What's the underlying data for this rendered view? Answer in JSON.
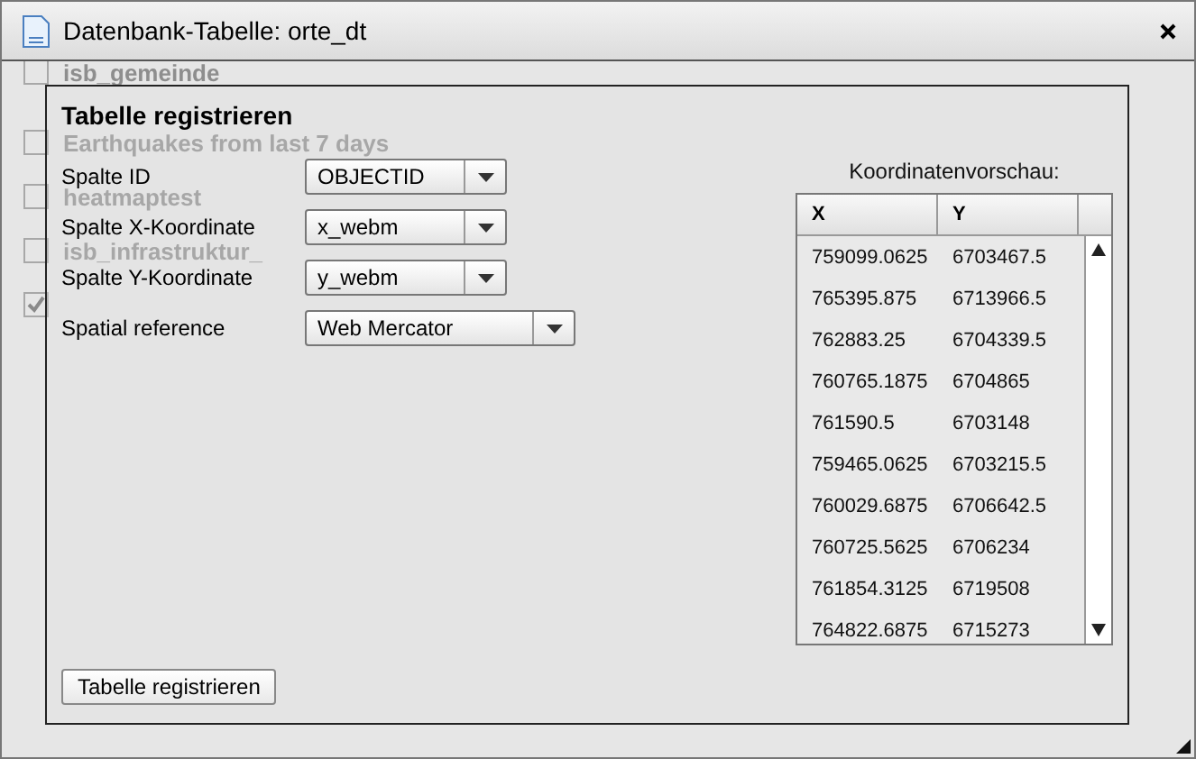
{
  "window": {
    "title": "Datenbank-Tabelle: orte_dt"
  },
  "background_layers": [
    {
      "name": "isb_gemeinde",
      "checked": false
    },
    {
      "name": "Earthquakes from last 7 days",
      "checked": false
    },
    {
      "name": "heatmaptest",
      "checked": false
    },
    {
      "name": "isb_infrastruktur_",
      "checked": false
    },
    {
      "checked": true
    }
  ],
  "panel": {
    "title": "Tabelle registrieren",
    "fields": [
      {
        "label": "Spalte ID",
        "value": "OBJECTID",
        "wide": false
      },
      {
        "label": "Spalte X-Koordinate",
        "value": "x_webm",
        "wide": false
      },
      {
        "label": "Spalte Y-Koordinate",
        "value": "y_webm",
        "wide": false
      },
      {
        "label": "Spatial reference",
        "value": "Web Mercator",
        "wide": true
      }
    ],
    "preview": {
      "title": "Koordinatenvorschau:",
      "columns": [
        "X",
        "Y"
      ],
      "rows": [
        [
          "759099.0625",
          "6703467.5"
        ],
        [
          "765395.875",
          "6713966.5"
        ],
        [
          "762883.25",
          "6704339.5"
        ],
        [
          "760765.1875",
          "6704865"
        ],
        [
          "761590.5",
          "6703148"
        ],
        [
          "759465.0625",
          "6703215.5"
        ],
        [
          "760029.6875",
          "6706642.5"
        ],
        [
          "760725.5625",
          "6706234"
        ],
        [
          "761854.3125",
          "6719508"
        ],
        [
          "764822.6875",
          "6715273"
        ]
      ]
    },
    "button": "Tabelle registrieren"
  }
}
